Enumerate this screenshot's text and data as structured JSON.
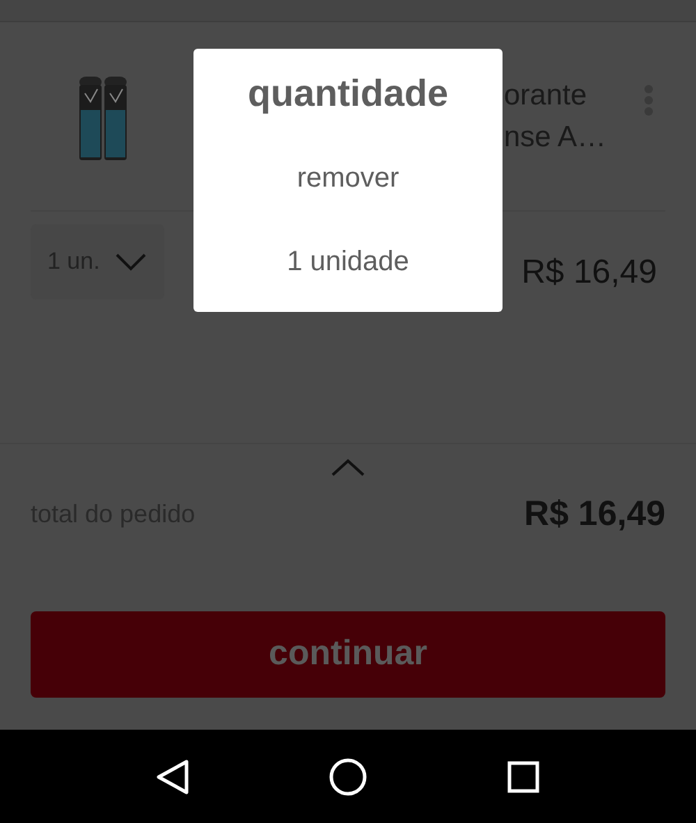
{
  "product": {
    "title_lines": [
      "orante",
      "nse A…"
    ],
    "quantity": "1 un.",
    "price": "R$ 16,49"
  },
  "summary": {
    "label": "total do pedido",
    "total": "R$ 16,49"
  },
  "continue_button": {
    "label": "continuar"
  },
  "dialog": {
    "title": "quantidade",
    "options": [
      {
        "label": "remover"
      },
      {
        "label": "1 unidade"
      }
    ]
  }
}
